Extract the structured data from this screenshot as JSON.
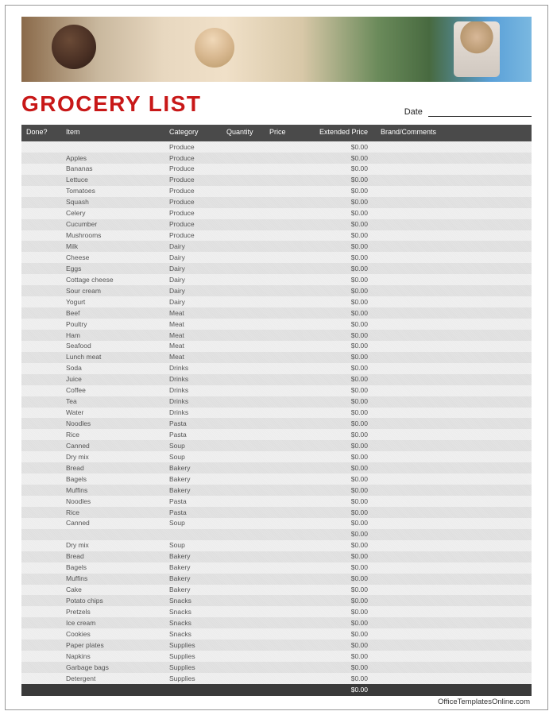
{
  "title": "GROCERY LIST",
  "dateLabel": "Date",
  "footer": "OfficeTemplatesOnline.com",
  "totalExtended": "$0.00",
  "columns": {
    "done": "Done?",
    "item": "Item",
    "category": "Category",
    "quantity": "Quantity",
    "price": "Price",
    "extended": "Extended Price",
    "brand": "Brand/Comments"
  },
  "rows": [
    {
      "item": "",
      "category": "Produce",
      "ext": "$0.00"
    },
    {
      "item": "Apples",
      "category": "Produce",
      "ext": "$0.00"
    },
    {
      "item": "Bananas",
      "category": "Produce",
      "ext": "$0.00"
    },
    {
      "item": "Lettuce",
      "category": "Produce",
      "ext": "$0.00"
    },
    {
      "item": "Tomatoes",
      "category": "Produce",
      "ext": "$0.00"
    },
    {
      "item": "Squash",
      "category": "Produce",
      "ext": "$0.00"
    },
    {
      "item": "Celery",
      "category": "Produce",
      "ext": "$0.00"
    },
    {
      "item": "Cucumber",
      "category": "Produce",
      "ext": "$0.00"
    },
    {
      "item": "Mushrooms",
      "category": "Produce",
      "ext": "$0.00"
    },
    {
      "item": "Milk",
      "category": "Dairy",
      "ext": "$0.00"
    },
    {
      "item": "Cheese",
      "category": "Dairy",
      "ext": "$0.00"
    },
    {
      "item": "Eggs",
      "category": "Dairy",
      "ext": "$0.00"
    },
    {
      "item": "Cottage cheese",
      "category": "Dairy",
      "ext": "$0.00"
    },
    {
      "item": "Sour cream",
      "category": "Dairy",
      "ext": "$0.00"
    },
    {
      "item": "Yogurt",
      "category": "Dairy",
      "ext": "$0.00"
    },
    {
      "item": "Beef",
      "category": "Meat",
      "ext": "$0.00"
    },
    {
      "item": "Poultry",
      "category": "Meat",
      "ext": "$0.00"
    },
    {
      "item": "Ham",
      "category": "Meat",
      "ext": "$0.00"
    },
    {
      "item": "Seafood",
      "category": "Meat",
      "ext": "$0.00"
    },
    {
      "item": "Lunch meat",
      "category": "Meat",
      "ext": "$0.00"
    },
    {
      "item": "Soda",
      "category": "Drinks",
      "ext": "$0.00"
    },
    {
      "item": "Juice",
      "category": "Drinks",
      "ext": "$0.00"
    },
    {
      "item": "Coffee",
      "category": "Drinks",
      "ext": "$0.00"
    },
    {
      "item": "Tea",
      "category": "Drinks",
      "ext": "$0.00"
    },
    {
      "item": "Water",
      "category": "Drinks",
      "ext": "$0.00"
    },
    {
      "item": "Noodles",
      "category": "Pasta",
      "ext": "$0.00"
    },
    {
      "item": "Rice",
      "category": "Pasta",
      "ext": "$0.00"
    },
    {
      "item": "Canned",
      "category": "Soup",
      "ext": "$0.00"
    },
    {
      "item": "Dry mix",
      "category": "Soup",
      "ext": "$0.00"
    },
    {
      "item": "Bread",
      "category": "Bakery",
      "ext": "$0.00"
    },
    {
      "item": "Bagels",
      "category": "Bakery",
      "ext": "$0.00"
    },
    {
      "item": "Muffins",
      "category": "Bakery",
      "ext": "$0.00"
    },
    {
      "item": "Noodles",
      "category": "Pasta",
      "ext": "$0.00"
    },
    {
      "item": "Rice",
      "category": "Pasta",
      "ext": "$0.00"
    },
    {
      "item": "Canned",
      "category": "Soup",
      "ext": "$0.00"
    },
    {
      "item": "",
      "category": "",
      "ext": "$0.00"
    },
    {
      "item": "Dry mix",
      "category": "Soup",
      "ext": "$0.00"
    },
    {
      "item": "Bread",
      "category": "Bakery",
      "ext": "$0.00"
    },
    {
      "item": "Bagels",
      "category": "Bakery",
      "ext": "$0.00"
    },
    {
      "item": "Muffins",
      "category": "Bakery",
      "ext": "$0.00"
    },
    {
      "item": "Cake",
      "category": "Bakery",
      "ext": "$0.00"
    },
    {
      "item": "Potato chips",
      "category": "Snacks",
      "ext": "$0.00"
    },
    {
      "item": "Pretzels",
      "category": "Snacks",
      "ext": "$0.00"
    },
    {
      "item": "Ice cream",
      "category": "Snacks",
      "ext": "$0.00"
    },
    {
      "item": "Cookies",
      "category": "Snacks",
      "ext": "$0.00"
    },
    {
      "item": "Paper plates",
      "category": "Supplies",
      "ext": "$0.00"
    },
    {
      "item": "Napkins",
      "category": "Supplies",
      "ext": "$0.00"
    },
    {
      "item": "Garbage bags",
      "category": "Supplies",
      "ext": "$0.00"
    },
    {
      "item": "Detergent",
      "category": "Supplies",
      "ext": "$0.00"
    }
  ]
}
